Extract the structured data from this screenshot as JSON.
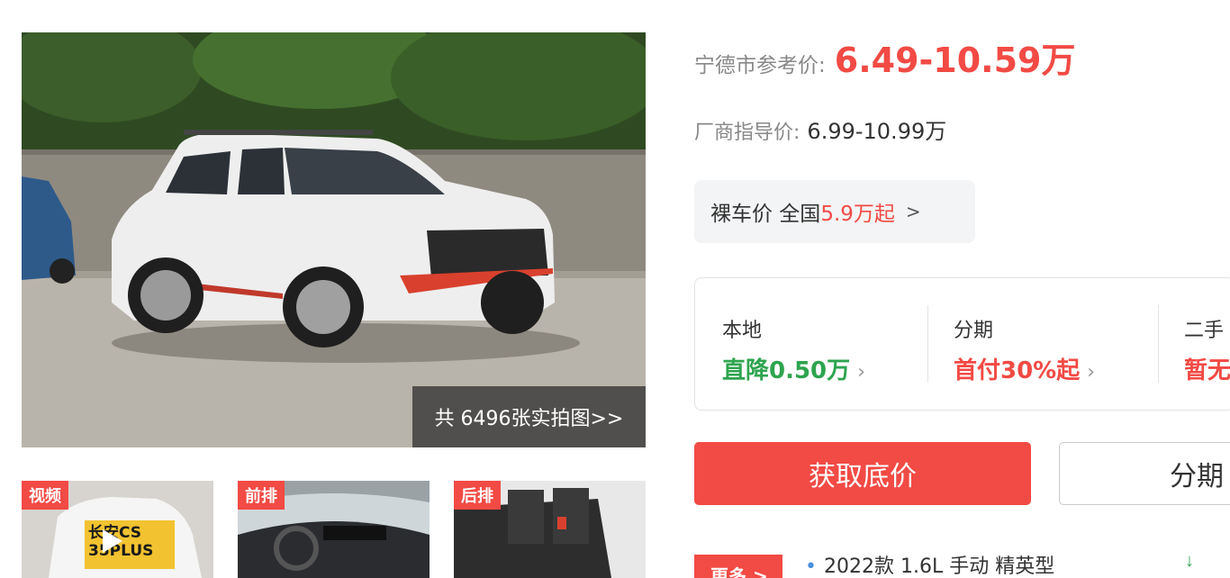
{
  "gallery": {
    "photo_count_label": "共 6496张实拍图>>",
    "thumbnails": [
      {
        "tag": "视频",
        "type": "video",
        "plate_text": "长安CS 35PLUS"
      },
      {
        "tag": "前排",
        "type": "image"
      },
      {
        "tag": "后排",
        "type": "image"
      }
    ]
  },
  "pricing": {
    "reference_label": "宁德市参考价:",
    "reference_value": "6.49-10.59万",
    "guide_label": "厂商指导价:",
    "guide_value": "6.99-10.99万",
    "naked": {
      "label": "裸车价 全国",
      "value": "5.9万起",
      "arrow": ">"
    }
  },
  "deals": [
    {
      "title": "本地",
      "value": "直降0.50万",
      "color": "#2ea44f"
    },
    {
      "title": "分期",
      "value": "首付30%起",
      "color": "#f24a44"
    },
    {
      "title": "二手",
      "value": "暂无",
      "color": "#f24a44"
    }
  ],
  "actions": {
    "primary_label": "获取底价",
    "secondary_label": "分期"
  },
  "variants": {
    "more_label": "更多 >",
    "items": [
      "2022款 1.6L 手动 精英型"
    ]
  },
  "colors": {
    "accent": "#f24a44",
    "green": "#2ea44f"
  }
}
